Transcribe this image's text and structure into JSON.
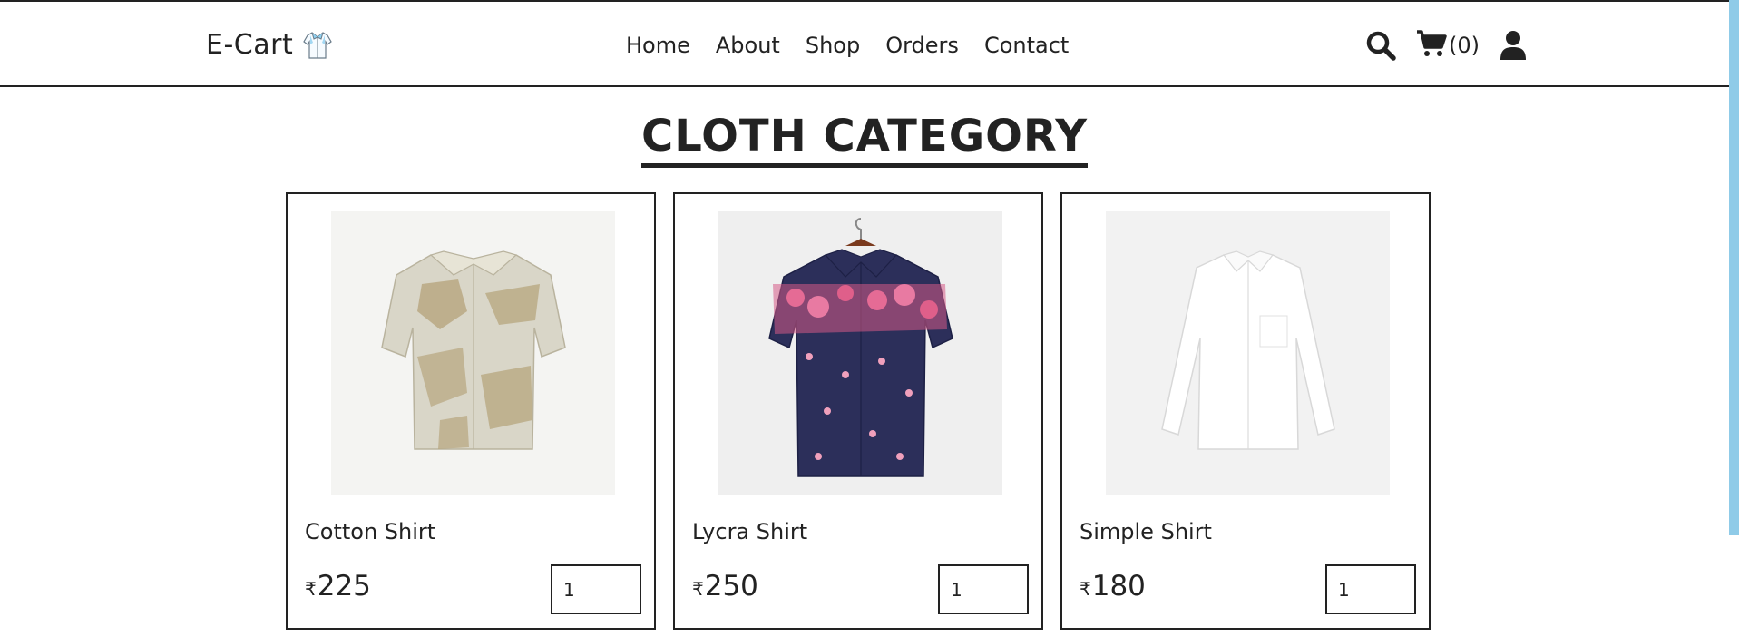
{
  "brand": {
    "name": "E-Cart",
    "icon": "shirt-logo-icon"
  },
  "nav": {
    "items": [
      {
        "label": "Home"
      },
      {
        "label": "About"
      },
      {
        "label": "Shop"
      },
      {
        "label": "Orders"
      },
      {
        "label": "Contact"
      }
    ]
  },
  "header_actions": {
    "search_icon": "search-icon",
    "cart_icon": "cart-icon",
    "cart_count": "(0)",
    "user_icon": "user-icon"
  },
  "section": {
    "title": "CLOTH CATEGORY"
  },
  "products": [
    {
      "name": "Cotton Shirt",
      "currency": "₹",
      "price": "225",
      "quantity": "1"
    },
    {
      "name": "Lycra Shirt",
      "currency": "₹",
      "price": "250",
      "quantity": "1"
    },
    {
      "name": "Simple Shirt",
      "currency": "₹",
      "price": "180",
      "quantity": "1"
    }
  ],
  "colors": {
    "text": "#222222",
    "background": "#ffffff",
    "scrollbar_accent": "#8fcbe8",
    "image_bg": "#f3f3f3"
  }
}
